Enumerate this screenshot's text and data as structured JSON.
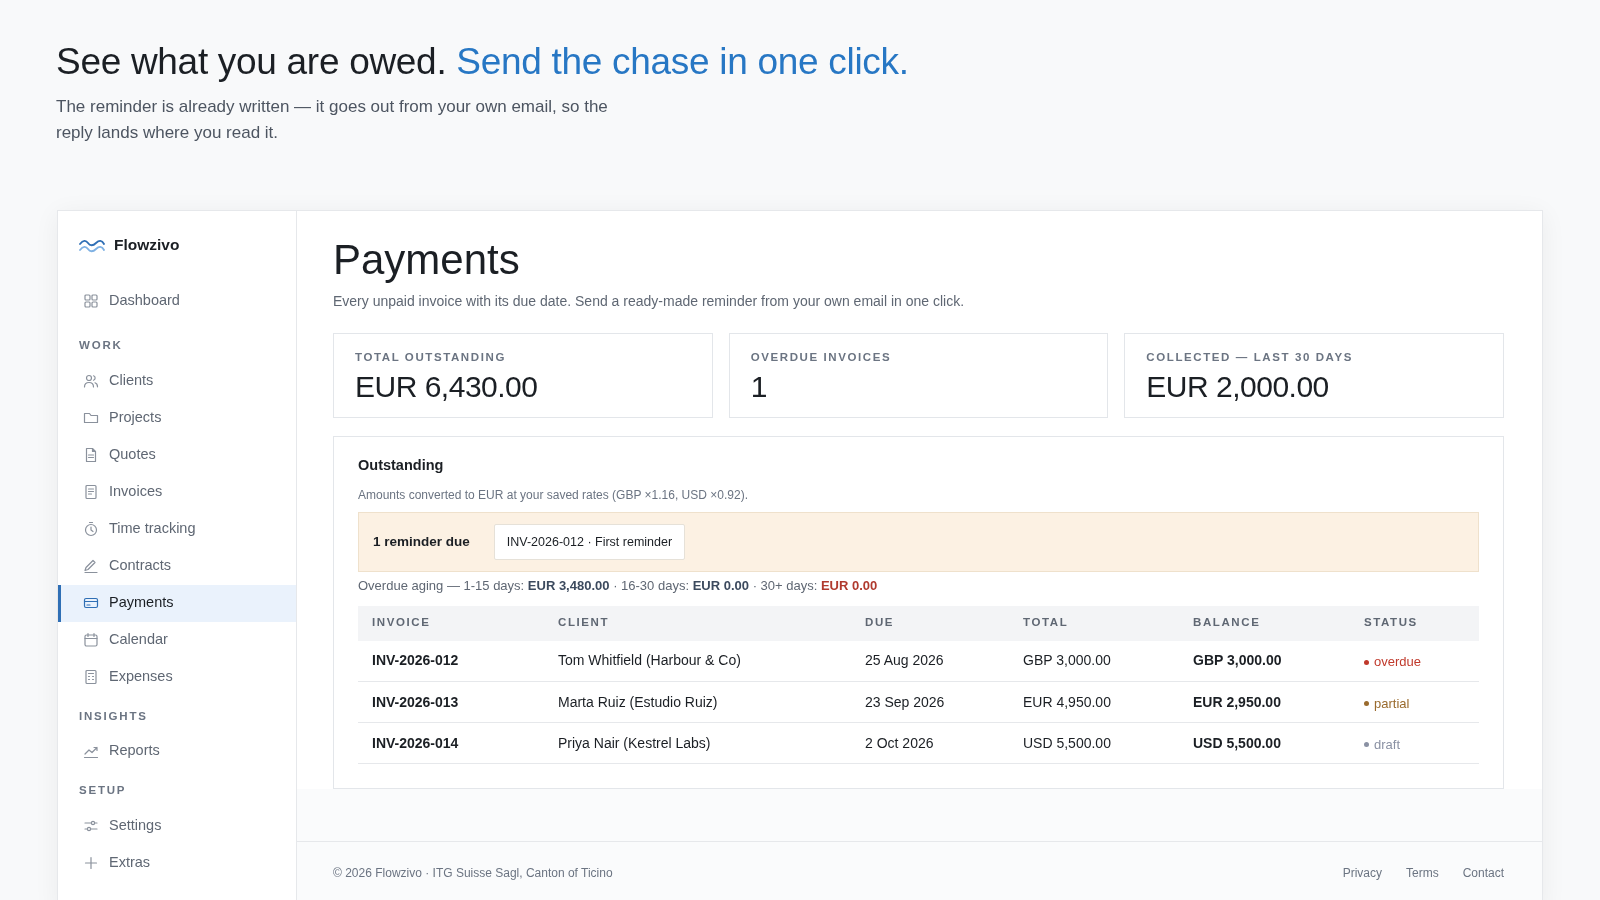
{
  "hero": {
    "headline": "See what you are owed.",
    "headline_accent": "Send the chase in one click.",
    "text": "The reminder is already written — it goes out from your own email, so the reply lands where you read it."
  },
  "sidebar": {
    "brand": "Flowzivo",
    "groups": [
      {
        "items": [
          {
            "label": "Dashboard",
            "selected": false
          }
        ]
      },
      {
        "heading": "WORK",
        "items": [
          {
            "label": "Clients",
            "selected": false
          },
          {
            "label": "Projects",
            "selected": false
          },
          {
            "label": "Quotes",
            "selected": false
          },
          {
            "label": "Invoices",
            "selected": false
          },
          {
            "label": "Time tracking",
            "selected": false
          },
          {
            "label": "Contracts",
            "selected": false
          },
          {
            "label": "Payments",
            "selected": true
          },
          {
            "label": "Calendar",
            "selected": false
          },
          {
            "label": "Expenses",
            "selected": false
          }
        ]
      },
      {
        "heading": "INSIGHTS",
        "items": [
          {
            "label": "Reports",
            "selected": false
          }
        ]
      },
      {
        "heading": "SETUP",
        "items": [
          {
            "label": "Settings",
            "selected": false
          },
          {
            "label": "Extras",
            "selected": false
          }
        ]
      }
    ]
  },
  "page": {
    "title": "Payments",
    "subtitle": "Every unpaid invoice with its due date. Send a ready-made reminder from your own email in one click."
  },
  "stats": [
    {
      "label": "TOTAL OUTSTANDING",
      "value": "EUR 6,430.00"
    },
    {
      "label": "OVERDUE INVOICES",
      "value": "1"
    },
    {
      "label": "COLLECTED — LAST 30 DAYS",
      "value": "EUR 2,000.00"
    }
  ],
  "outstanding": {
    "title": "Outstanding",
    "note": "Amounts converted to EUR at your saved rates (GBP ×1.16, USD ×0.92).",
    "reminder": {
      "label": "1 reminder due",
      "button": "INV-2026-012 · First reminder"
    },
    "aging": [
      {
        "label": "Overdue aging — 1-15 days:",
        "amount": "EUR 3,480.00",
        "alert": false
      },
      {
        "label": "· 16-30 days:",
        "amount": "EUR 0.00",
        "alert": false
      },
      {
        "label": "· 30+ days:",
        "amount": "EUR 0.00",
        "alert": true
      }
    ],
    "table": {
      "columns": [
        "INVOICE",
        "CLIENT",
        "DUE",
        "TOTAL",
        "BALANCE",
        "STATUS"
      ],
      "rows": [
        {
          "invoice": "INV-2026-012",
          "client": "Tom Whitfield (Harbour & Co)",
          "due": "25 Aug 2026",
          "total": "GBP 3,000.00",
          "balance": "GBP 3,000.00",
          "status": "overdue",
          "color": "#c0392b"
        },
        {
          "invoice": "INV-2026-013",
          "client": "Marta Ruiz (Estudio Ruiz)",
          "due": "23 Sep 2026",
          "total": "EUR 4,950.00",
          "balance": "EUR 2,950.00",
          "status": "partial",
          "color": "#9a6b2e"
        },
        {
          "invoice": "INV-2026-014",
          "client": "Priya Nair (Kestrel Labs)",
          "due": "2 Oct 2026",
          "total": "USD 5,500.00",
          "balance": "USD 5,500.00",
          "status": "draft",
          "color": "#8a91a3"
        }
      ]
    }
  },
  "footer": {
    "text": "© 2026 Flowzivo · ITG Suisse Sagl, Canton of Ticino",
    "links": [
      "Privacy",
      "Terms",
      "Contact"
    ]
  }
}
